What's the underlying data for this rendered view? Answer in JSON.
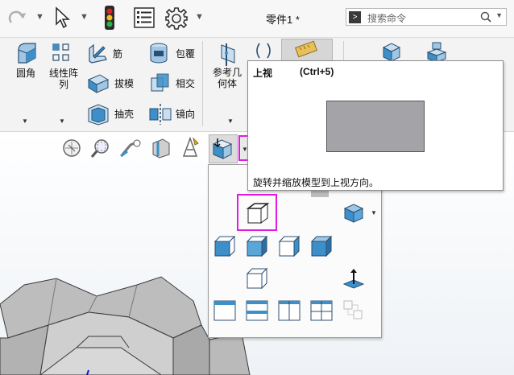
{
  "titlebar": {
    "document_title": "零件1 *",
    "search_placeholder": "搜索命令",
    "search_prompt": ">"
  },
  "ribbon": {
    "fillet_label": "圆角",
    "linear_pattern_label": "线性阵\n列",
    "rib_label": "筋",
    "wrap_label": "包覆",
    "draft_label": "拔模",
    "intersect_label": "相交",
    "shell_label": "抽壳",
    "mirror_label": "镜向",
    "reference_geometry_label": "参考几\n何体"
  },
  "tooltip": {
    "title": "上视",
    "shortcut": "(Ctrl+5)",
    "description": "旋转并缩放模型到上视方向。"
  },
  "colors": {
    "highlight": "#e21be0",
    "cube_blue": "#3c8fc8",
    "tooltip_swatch": "#a4a4a8"
  }
}
